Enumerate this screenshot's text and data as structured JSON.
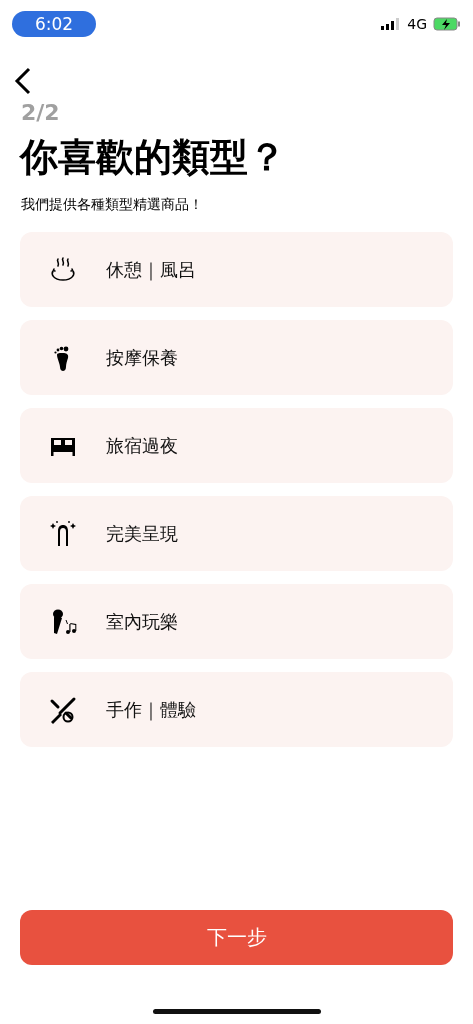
{
  "status_bar": {
    "time": "6:02",
    "network": "4G"
  },
  "step": "2/2",
  "title": "你喜歡的類型？",
  "subtitle": "我們提供各種類型精選商品！",
  "categories": [
    {
      "kind": "hotspring",
      "label": "休憩｜風呂",
      "selected": false
    },
    {
      "kind": "foot",
      "label": "按摩保養",
      "selected": false
    },
    {
      "kind": "bed",
      "label": "旅宿過夜",
      "selected": false
    },
    {
      "kind": "nail",
      "label": "完美呈現",
      "selected": false
    },
    {
      "kind": "karaoke",
      "label": "室內玩樂",
      "selected": false
    },
    {
      "kind": "tools",
      "label": "手作｜體驗",
      "selected": false
    }
  ],
  "next_button": "下一步"
}
